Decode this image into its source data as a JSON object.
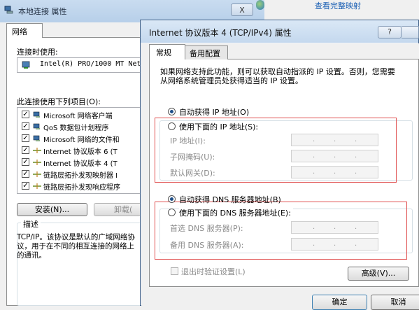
{
  "bg_dialog": {
    "title": "本地连接 属性",
    "close_label": "X",
    "top_link": "查看完整映射",
    "tab_label": "网络",
    "connect_using_label": "连接时使用:",
    "adapter_name": "Intel(R) PRO/1000 MT Netw",
    "items_label": "此连接使用下列项目(O):",
    "items": [
      {
        "label": "Microsoft 网络客户端",
        "checked": true,
        "icon": "network-client-icon"
      },
      {
        "label": "QoS 数据包计划程序",
        "checked": true,
        "icon": "qos-icon"
      },
      {
        "label": "Microsoft 网络的文件和",
        "checked": true,
        "icon": "file-sharing-icon"
      },
      {
        "label": "Internet 协议版本 6 (T",
        "checked": true,
        "icon": "protocol-icon"
      },
      {
        "label": "Internet 协议版本 4 (T",
        "checked": true,
        "icon": "protocol-icon"
      },
      {
        "label": "链路层拓扑发现映射器 I",
        "checked": true,
        "icon": "protocol-icon"
      },
      {
        "label": "链路层拓扑发现响应程序",
        "checked": true,
        "icon": "protocol-icon"
      }
    ],
    "install_label": "安装(N)...",
    "uninstall_label": "卸载(",
    "description_legend": "描述",
    "description_text": "TCP/IP。该协议是默认的广域网络协议，用于在不同的相互连接的网络上的通讯。"
  },
  "dialog": {
    "title": "Internet 协议版本 4 (TCP/IPv4) 属性",
    "help_label": "?",
    "tabs": [
      {
        "label": "常规",
        "active": true
      },
      {
        "label": "备用配置",
        "active": false
      }
    ],
    "intro": "如果网络支持此功能，则可以获取自动指派的 IP 设置。否则，您需要从网络系统管理员处获得适当的 IP 设置。",
    "ip": {
      "auto_label": "自动获得 IP 地址(O)",
      "manual_label": "使用下面的 IP 地址(S):",
      "selected": "auto",
      "fields": [
        {
          "label": "IP 地址(I):",
          "value": ""
        },
        {
          "label": "子网掩码(U):",
          "value": ""
        },
        {
          "label": "默认网关(D):",
          "value": ""
        }
      ]
    },
    "dns": {
      "auto_label": "自动获得 DNS 服务器地址(B)",
      "manual_label": "使用下面的 DNS 服务器地址(E):",
      "selected": "auto",
      "fields": [
        {
          "label": "首选 DNS 服务器(P):",
          "value": ""
        },
        {
          "label": "备用 DNS 服务器(A):",
          "value": ""
        }
      ]
    },
    "validate_label": "退出时验证设置(L)",
    "advanced_label": "高级(V)...",
    "ok_label": "确定",
    "cancel_label": "取消"
  },
  "colors": {
    "highlight_box": "#e05050",
    "selected_radio": "#1d4e89"
  }
}
